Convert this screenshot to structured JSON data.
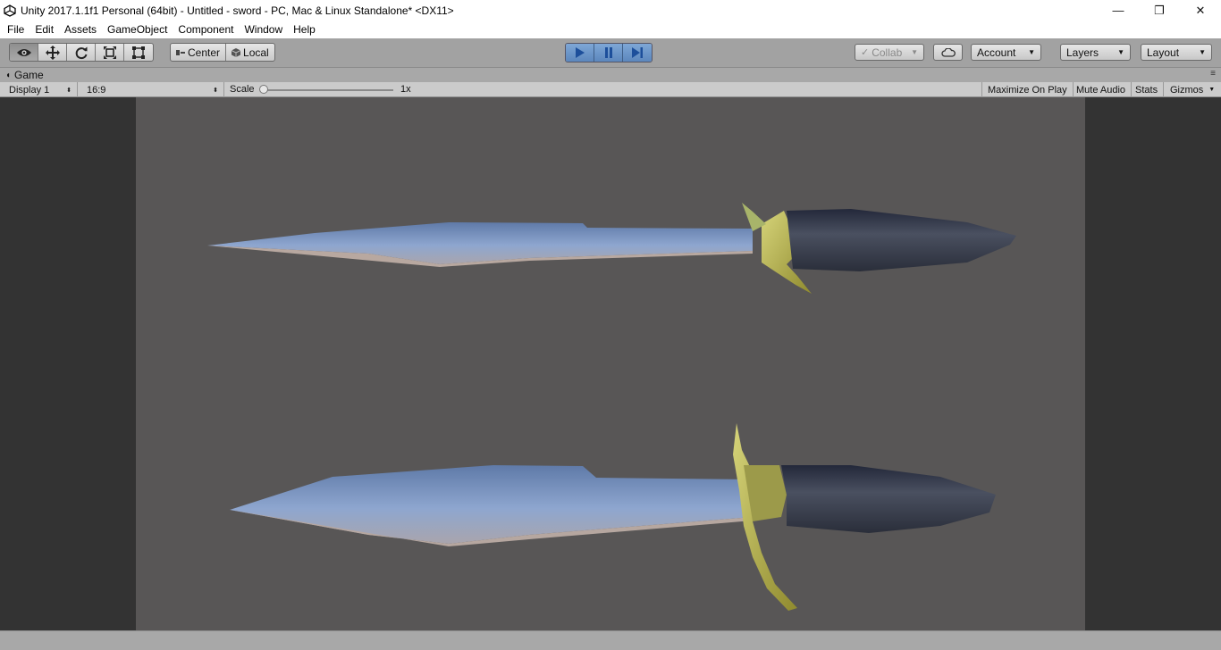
{
  "window": {
    "title": "Unity 2017.1.1f1 Personal (64bit) - Untitled - sword - PC, Mac & Linux Standalone* <DX11>",
    "controls": {
      "minimize": "—",
      "restore": "❐",
      "close": "✕"
    }
  },
  "menu": {
    "items": [
      {
        "label": "File"
      },
      {
        "label": "Edit"
      },
      {
        "label": "Assets"
      },
      {
        "label": "GameObject"
      },
      {
        "label": "Component"
      },
      {
        "label": "Window"
      },
      {
        "label": "Help"
      }
    ]
  },
  "toolbar": {
    "tools": [
      "view-tool",
      "move-tool",
      "rotate-tool",
      "scale-tool",
      "rect-tool"
    ],
    "pivot_mode": "Center",
    "pivot_rotation": "Local",
    "collab_label": "Collab",
    "account_label": "Account",
    "layers_label": "Layers",
    "layout_label": "Layout"
  },
  "game_view": {
    "tab_label": "Game",
    "display": "Display 1",
    "aspect": "16:9",
    "scale_label": "Scale",
    "scale_value": "1x",
    "maximize_label": "Maximize On Play",
    "mute_label": "Mute Audio",
    "stats_label": "Stats",
    "gizmos_label": "Gizmos"
  },
  "colors": {
    "play_active": "#5c87bd",
    "viewport_bg": "#585656",
    "blade": "#7d96bf",
    "guard": "#b9b55a",
    "handle": "#2f3748"
  }
}
